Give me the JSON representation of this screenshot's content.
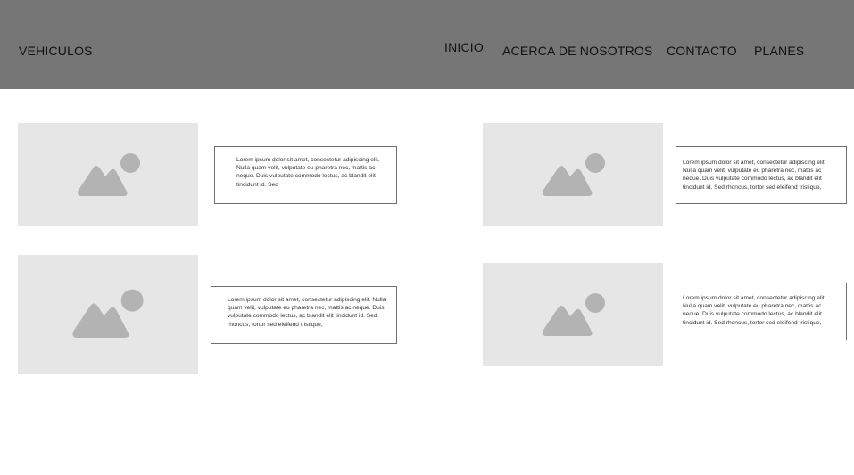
{
  "header": {
    "brand": "VEHICULOS",
    "nav": {
      "inicio": "INICIO",
      "acerca": "ACERCA DE NOSOTROS",
      "contacto": "CONTACTO",
      "planes": "PLANES"
    }
  },
  "cards": [
    {
      "image_icon": "image-placeholder-icon",
      "text": "Lorem ipsum dolor sit amet, consectetur adipiscing elit. Nulla quam velit, vulputate eu pharetra nec, mattis ac neque. Duis vulputate commodo lectus, ac blandit elit tincidunt id. Sed"
    },
    {
      "image_icon": "image-placeholder-icon",
      "text": "Lorem ipsum dolor sit amet, consectetur adipiscing elit. Nulla quam velit, vulputate eu pharetra nec, mattis ac neque. Duis vulputate commodo lectus, ac blandit elit tincidunt id. Sed rhoncus, tortor sed eleifend tristique,"
    },
    {
      "image_icon": "image-placeholder-icon",
      "text": "Lorem ipsum dolor sit amet, consectetur adipiscing elit. Nulla quam velit, vulputate eu pharetra nec, mattis ac neque. Duis vulputate commodo lectus, ac blandit elit tincidunt id. Sed rhoncus, tortor sed eleifend tristique,"
    },
    {
      "image_icon": "image-placeholder-icon",
      "text": "Lorem ipsum dolor sit amet, consectetur adipiscing elit. Nulla quam velit, vulputate eu pharetra nec, mattis ac neque. Duis vulputate commodo lectus, ac blandit elit tincidunt id. Sed rhoncus, tortor sed eleifend tristique,"
    }
  ],
  "colors": {
    "header_bg": "#767676",
    "placeholder_bg": "#e6e6e6",
    "placeholder_icon": "#b3b3b3"
  }
}
